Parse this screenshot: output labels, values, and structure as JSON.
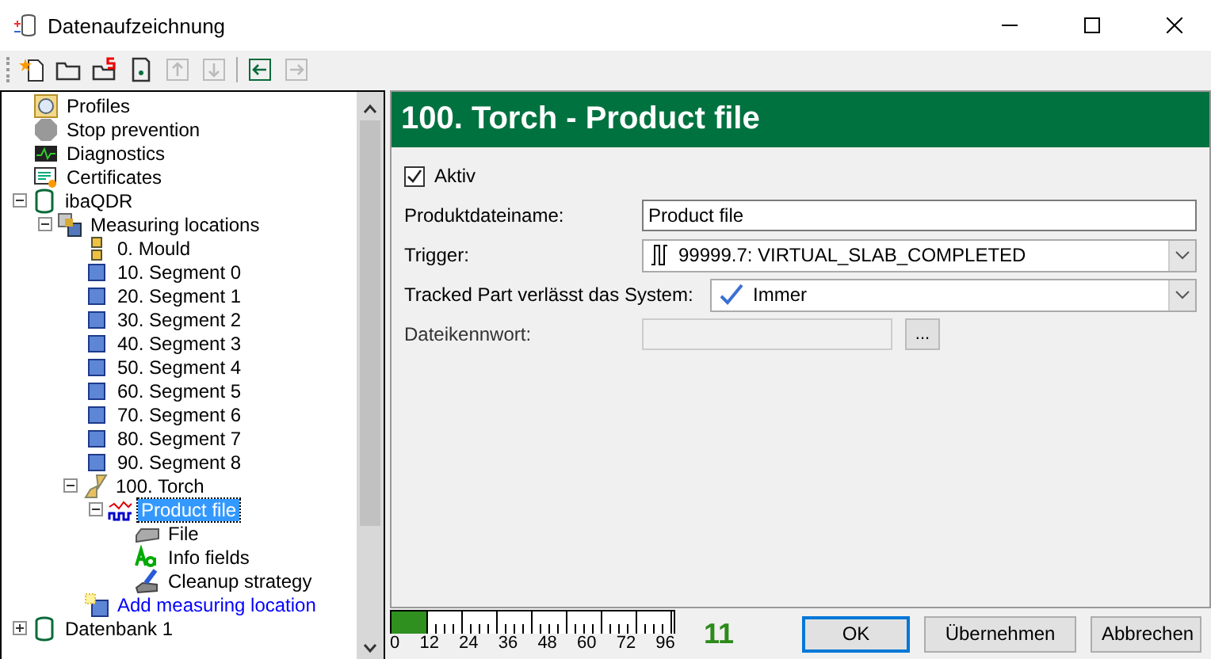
{
  "window": {
    "title": "Datenaufzeichnung"
  },
  "toolbar": [
    {
      "kind": "new",
      "disabled": false
    },
    {
      "kind": "open",
      "disabled": false
    },
    {
      "kind": "open-special",
      "disabled": false
    },
    {
      "kind": "save",
      "disabled": false
    },
    {
      "kind": "up",
      "disabled": true
    },
    {
      "kind": "down",
      "disabled": true
    },
    {
      "kind": "sep"
    },
    {
      "kind": "back",
      "disabled": false
    },
    {
      "kind": "forward",
      "disabled": true
    }
  ],
  "tree": [
    {
      "label": "Profiles",
      "kind": "profile",
      "selected": false
    },
    {
      "label": "Stop prevention",
      "kind": "stop",
      "selected": false
    },
    {
      "label": "Diagnostics",
      "kind": "diagnostics",
      "selected": false
    },
    {
      "label": "Certificates",
      "kind": "certificate",
      "selected": false
    },
    {
      "label": "ibaQDR",
      "kind": "database",
      "selected": false,
      "expanded": true,
      "children": [
        {
          "label": "Measuring locations",
          "kind": "locations",
          "selected": false,
          "expanded": true,
          "children": [
            {
              "label": "0. Mould",
              "kind": "mould",
              "selected": false
            },
            {
              "label": "10. Segment 0",
              "kind": "segment",
              "selected": false
            },
            {
              "label": "20. Segment 1",
              "kind": "segment",
              "selected": false
            },
            {
              "label": "30. Segment 2",
              "kind": "segment",
              "selected": false
            },
            {
              "label": "40. Segment 3",
              "kind": "segment",
              "selected": false
            },
            {
              "label": "50. Segment 4",
              "kind": "segment",
              "selected": false
            },
            {
              "label": "60. Segment 5",
              "kind": "segment",
              "selected": false
            },
            {
              "label": "70. Segment 6",
              "kind": "segment",
              "selected": false
            },
            {
              "label": "80. Segment 7",
              "kind": "segment",
              "selected": false
            },
            {
              "label": "90. Segment 8",
              "kind": "segment",
              "selected": false
            },
            {
              "label": "100. Torch",
              "kind": "torch",
              "selected": false,
              "expanded": true,
              "children": [
                {
                  "label": "Product file",
                  "kind": "productfile",
                  "selected": true,
                  "expanded": true,
                  "children": [
                    {
                      "label": "File",
                      "kind": "file",
                      "selected": false
                    },
                    {
                      "label": "Info fields",
                      "kind": "info",
                      "selected": false
                    },
                    {
                      "label": "Cleanup strategy",
                      "kind": "cleanup",
                      "selected": false
                    }
                  ]
                }
              ]
            },
            {
              "label": "Add measuring location",
              "kind": "add",
              "selected": false
            }
          ]
        }
      ]
    },
    {
      "label": "Datenbank 1",
      "kind": "database",
      "selected": false,
      "expanded": false
    }
  ],
  "panel": {
    "title": "100. Torch - Product file",
    "active": {
      "label": "Aktiv",
      "checked": true
    },
    "fields": [
      {
        "kind": "text",
        "label": "Produktdateiname:",
        "value": "Product file"
      },
      {
        "kind": "trigger",
        "label": "Trigger:",
        "value": "99999.7: VIRTUAL_SLAB_COMPLETED"
      },
      {
        "kind": "check",
        "label": "Tracked Part verlässt das System:",
        "value": "Immer"
      },
      {
        "kind": "password",
        "label": "Dateikennwort:",
        "disabled": true,
        "button": "..."
      }
    ]
  },
  "meter": {
    "level": 0.125,
    "ticks": [
      "0",
      "12",
      "24",
      "36",
      "48",
      "60",
      "72",
      "96"
    ],
    "reading": "11"
  },
  "buttons": [
    {
      "label": "OK",
      "default": true
    },
    {
      "label": "Übernehmen",
      "default": false
    },
    {
      "label": "Abbrechen",
      "default": false
    }
  ]
}
